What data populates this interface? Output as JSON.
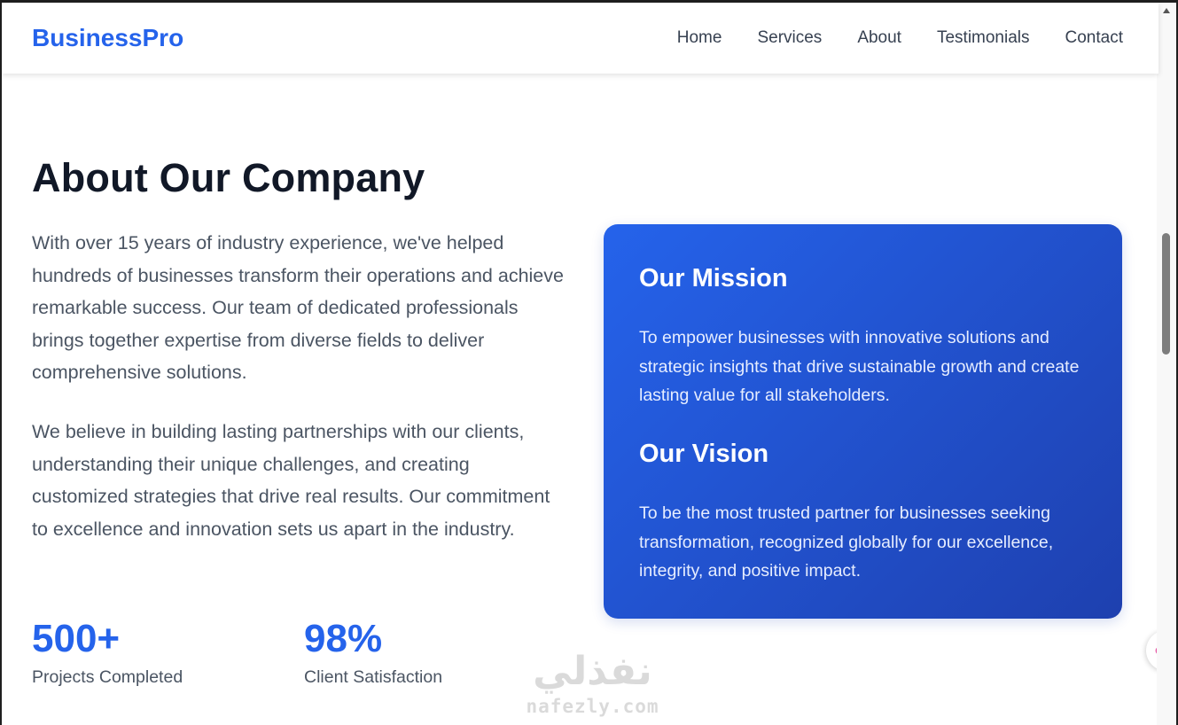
{
  "nav": {
    "brand": "BusinessPro",
    "links": [
      "Home",
      "Services",
      "About",
      "Testimonials",
      "Contact"
    ]
  },
  "about": {
    "title": "About Our Company",
    "paragraphs": [
      "With over 15 years of industry experience, we've helped hundreds of businesses transform their operations and achieve remarkable success. Our team of dedicated professionals brings together expertise from diverse fields to deliver comprehensive solutions.",
      "We believe in building lasting partnerships with our clients, understanding their unique challenges, and creating customized strategies that drive real results. Our commitment to excellence and innovation sets us apart in the industry."
    ],
    "stats": [
      {
        "number": "500+",
        "label": "Projects Completed"
      },
      {
        "number": "98%",
        "label": "Client Satisfaction"
      }
    ]
  },
  "card": {
    "mission_title": "Our Mission",
    "mission_text": "To empower businesses with innovative solutions and strategic insights that drive sustainable growth and create lasting value for all stakeholders.",
    "vision_title": "Our Vision",
    "vision_text": "To be the most trusted partner for businesses seeking transformation, recognized globally for our excellence, integrity, and positive impact."
  },
  "watermark": {
    "arabic": "نفذلي",
    "latin": "nafezly.com"
  },
  "colors": {
    "brand": "#2563eb",
    "card_start": "#2563eb",
    "card_end": "#1e40af",
    "heading": "#111827",
    "body_text": "#4b5563"
  },
  "icons": {
    "floating_widget": "brain-icon"
  }
}
